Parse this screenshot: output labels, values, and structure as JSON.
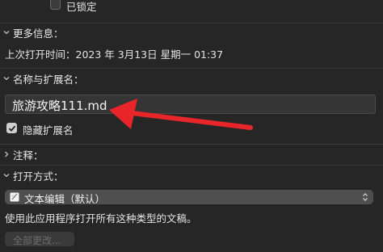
{
  "locked": {
    "label": "已锁定",
    "checked": false
  },
  "more_info": {
    "title": "更多信息：",
    "last_opened": "上次打开时间：2023 年 3月13日 星期一 01:37"
  },
  "name_ext": {
    "title": "名称与扩展名：",
    "filename": "旅游攻略111.md",
    "hide_ext_label": "隐藏扩展名",
    "hide_ext_checked": true
  },
  "comments": {
    "title": "注释："
  },
  "open_with": {
    "title": "打开方式：",
    "app": "文本编辑（默认）",
    "description": "使用此应用程序打开所有这种类型的文稿。",
    "change_all_label": "全部更改..."
  },
  "annotation": {
    "arrow_color": "#e8262a"
  }
}
